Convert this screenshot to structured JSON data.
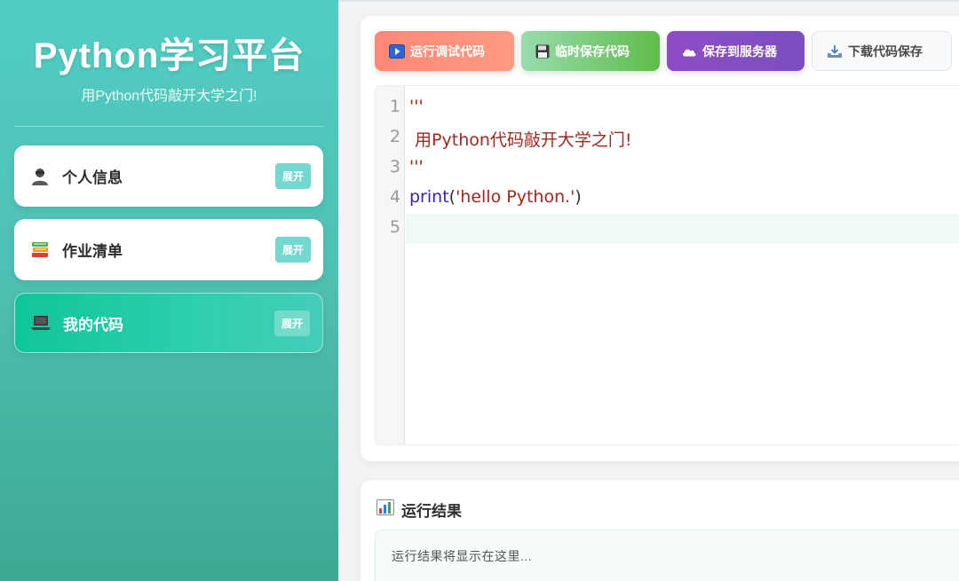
{
  "sidebar": {
    "title": "Python学习平台",
    "subtitle": "用Python代码敲开大学之门!",
    "items": [
      {
        "label": "个人信息",
        "expand": "展开",
        "icon": "user-icon",
        "active": false
      },
      {
        "label": "作业清单",
        "expand": "展开",
        "icon": "books-icon",
        "active": false
      },
      {
        "label": "我的代码",
        "expand": "展开",
        "icon": "laptop-icon",
        "active": true
      }
    ]
  },
  "toolbar": {
    "run_label": "运行调试代码",
    "temp_save_label": "临时保存代码",
    "server_save_label": "保存到服务器",
    "download_label": "下载代码保存"
  },
  "editor": {
    "line_numbers": [
      "1",
      "2",
      "3",
      "4",
      "5"
    ],
    "lines": {
      "l1": "'''",
      "l2": " 用Python代码敲开大学之门!",
      "l3": "'''",
      "l4_kw": "print",
      "l4_open": "(",
      "l4_str": "'hello Python.'",
      "l4_close": ")"
    }
  },
  "result": {
    "title": "运行结果",
    "placeholder": "运行结果将显示在这里..."
  },
  "colors": {
    "sidebar_top": "#52cdc4",
    "sidebar_bottom": "#3ea893",
    "active_item": "#10c59a",
    "run_btn": "#ff8877",
    "temp_btn": "#5fbd4a",
    "server_btn": "#8e4cc5",
    "keyword": "#3f1eb4",
    "string": "#a3271e"
  }
}
